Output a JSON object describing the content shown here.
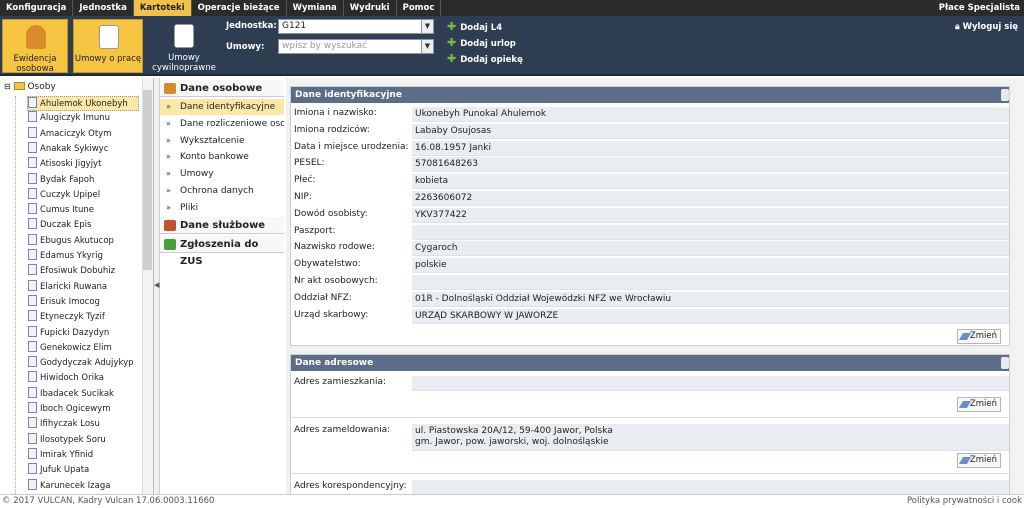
{
  "menubar": {
    "items": [
      "Konfiguracja",
      "Jednostka",
      "Kartoteki",
      "Operacje bieżące",
      "Wymiana",
      "Wydruki",
      "Pomoc"
    ],
    "active_index": 2,
    "app_name": "Płace Specjalista"
  },
  "toolbar": {
    "buttons": [
      "Ewidencja osobowa",
      "Umowy o pracę",
      "Umowy cywilnoprawne"
    ],
    "jednostka_label": "Jednostka:",
    "jednostka_value": "G121",
    "umowy_label": "Umowy:",
    "umowy_placeholder": "wpisz by wyszukać",
    "actions": [
      "Dodaj L4",
      "Dodaj urlop",
      "Dodaj opiekę"
    ],
    "logout": "Wyloguj się"
  },
  "tree": {
    "root": "Osoby",
    "selected_index": 0,
    "items": [
      "Ahulemok Ukonebyh",
      "Alugiczyk Imunu",
      "Amaciczyk Otym",
      "Anakak Sykiwyc",
      "Atisoski Jigyjyt",
      "Bydak Fapoh",
      "Cuczyk Upipel",
      "Cumus Itune",
      "Duczak Epis",
      "Ebugus Akutucop",
      "Edamus Ykyrig",
      "Efosiwuk Dobuhiz",
      "Elaricki Ruwana",
      "Erisuk Imocog",
      "Etyneczyk Tyzif",
      "Fupicki Dazydyn",
      "Genekowicz Elim",
      "Godydyczak Adujykyp",
      "Hiwidoch Orika",
      "Ibadacek Sucikak",
      "Iboch Ogicewym",
      "Ifihyczak Losu",
      "Ilosotypek Soru",
      "Imirak Yfinid",
      "Jufuk Upata",
      "Karunecek Izaga"
    ]
  },
  "nav": {
    "section1": "Dane osobowe",
    "items": [
      "Dane identyfikacyjne",
      "Dane rozliczeniowe osoby",
      "Wykształcenie",
      "Konto bankowe",
      "Umowy",
      "Ochrona danych",
      "Pliki"
    ],
    "selected_index": 0,
    "section2": "Dane służbowe",
    "section3": "Zgłoszenia do ZUS"
  },
  "ident": {
    "title": "Dane identyfikacyjne",
    "rows": [
      {
        "label": "Imiona i nazwisko:",
        "value": "Ukonebyh Punokal Ahulemok"
      },
      {
        "label": "Imiona rodziców:",
        "value": "Lababy Osujosas"
      },
      {
        "label": "Data i miejsce urodzenia:",
        "value": "16.08.1957 Janki"
      },
      {
        "label": "PESEL:",
        "value": "57081648263"
      },
      {
        "label": "Płeć:",
        "value": "kobieta"
      },
      {
        "label": "NIP:",
        "value": "2263606072"
      },
      {
        "label": "Dowód osobisty:",
        "value": "YKV377422"
      },
      {
        "label": "Paszport:",
        "value": ""
      },
      {
        "label": "Nazwisko rodowe:",
        "value": "Cygaroch"
      },
      {
        "label": "Obywatelstwo:",
        "value": "polskie"
      },
      {
        "label": "Nr akt osobowych:",
        "value": ""
      },
      {
        "label": "Oddział NFZ:",
        "value": "01R - Dolnośląski Oddział Wojewódzki NFZ we Wrocławiu"
      },
      {
        "label": "Urząd skarbowy:",
        "value": "URZĄD SKARBOWY W JAWORZE"
      }
    ],
    "edit": "Zmień"
  },
  "address": {
    "title": "Dane adresowe",
    "zamieszkania_label": "Adres zamieszkania:",
    "zamieszkania_value": "",
    "zameldowania_label": "Adres zameldowania:",
    "zameldowania_line1": "ul. Piastowska 20A/12, 59-400 Jawor, Polska",
    "zameldowania_line2": "gm. Jawor, pow. jaworski, woj. dolnośląskie",
    "korespondencyjny_label": "Adres korespondencyjny:",
    "edit": "Zmień"
  },
  "footer": {
    "left": "© 2017 VULCAN, Kadry Vulcan 17.06.0003.11660",
    "right": "Polityka prywatności i cook"
  }
}
